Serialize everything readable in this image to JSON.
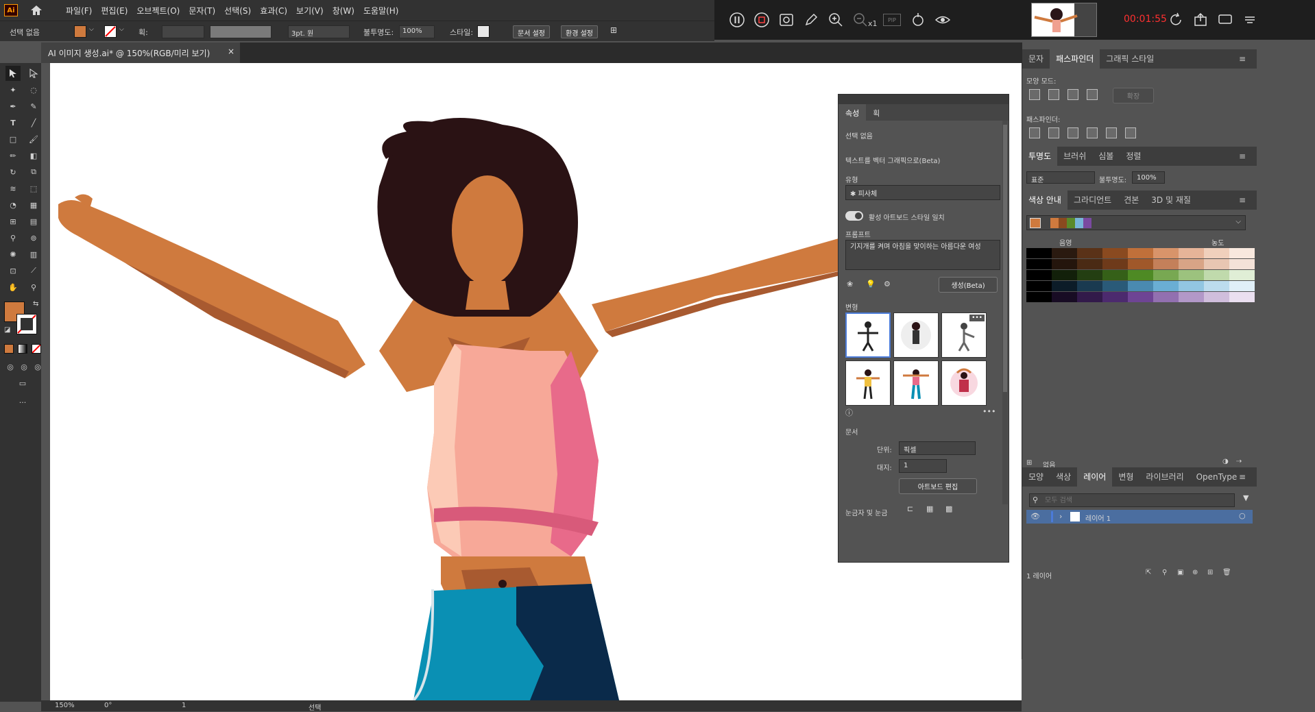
{
  "menubar": {
    "logo": "Ai",
    "items": [
      "파일(F)",
      "편집(E)",
      "오브젝트(O)",
      "문자(T)",
      "선택(S)",
      "효과(C)",
      "보기(V)",
      "창(W)",
      "도움말(H)"
    ]
  },
  "recorder": {
    "timer": "00:01:55",
    "zoom_label": "x1",
    "pip_label": "PIP"
  },
  "control": {
    "selection": "선택 없음",
    "stroke_label": "획:",
    "brush": "3pt. 원",
    "opacity_label": "불투명도:",
    "opacity": "100%",
    "style_label": "스타일:",
    "doc_setup": "문서 설정",
    "preferences": "환경 설정"
  },
  "tab": {
    "title": "AI 이미지 생성.ai* @ 150%(RGB/미리 보기)",
    "close": "×"
  },
  "status": {
    "zoom": "150%",
    "rotate": "0°",
    "artboard": "1",
    "tool": "선택"
  },
  "properties": {
    "tabs": [
      "속성",
      "획"
    ],
    "no_selection": "선택 없음",
    "section": "텍스트를 벡터 그래픽으로(Beta)",
    "type_label": "유형",
    "type_value": "피사체",
    "toggle_label": "활성 아트보드 스타일 일치",
    "prompt_label": "프롬프트",
    "prompt_text": "기지개를 켜며 아침을 맞이하는 아름다운 여성",
    "generate": "생성(Beta)",
    "variants_label": "변형",
    "document_label": "문서",
    "units_label": "단위:",
    "units_value": "픽셀",
    "artboard_label": "대지:",
    "artboard_value": "1",
    "edit_artboard": "아트보드 편집",
    "rulers_label": "눈금자 및 눈금"
  },
  "pathfinder": {
    "tabs": [
      "문자",
      "패스파인더",
      "그래픽 스타일"
    ],
    "shape_modes": "모양 모드:",
    "expand": "확장",
    "pathfinders": "패스파인더:"
  },
  "transparency": {
    "tabs": [
      "투명도",
      "브러쉬",
      "심볼",
      "정렬"
    ],
    "blend": "표준",
    "opacity_label": "불투명도:",
    "opacity": "100%"
  },
  "color_guide": {
    "tabs": [
      "색상 안내",
      "그라디언트",
      "견본",
      "3D 및 재질"
    ],
    "shade": "음영",
    "tint": "농도",
    "base_colors": [
      "#cf7a3e",
      "#cf7a3e",
      "#8a4a1f",
      "#5a8a2a",
      "#78b5d8",
      "#7a4aa0"
    ],
    "rows": [
      [
        "#000000",
        "#2a1a10",
        "#5a3218",
        "#8a4a20",
        "#c0703a",
        "#d8946a",
        "#e6b498",
        "#f0d0bc",
        "#f8e8de"
      ],
      [
        "#000000",
        "#24150c",
        "#4a2a14",
        "#6e3a1a",
        "#a0582a",
        "#c4805a",
        "#d8a486",
        "#e8c6b2",
        "#f4e2d8"
      ],
      [
        "#000000",
        "#12200a",
        "#233e12",
        "#356018",
        "#4e8a24",
        "#78a852",
        "#9cc27e",
        "#c0daac",
        "#e0eed6"
      ],
      [
        "#000000",
        "#0c1c28",
        "#1a3a50",
        "#2a5a78",
        "#4a8ab0",
        "#6aaed4",
        "#92c6e2",
        "#bcdcee",
        "#e0eff8"
      ],
      [
        "#000000",
        "#180c24",
        "#321a4a",
        "#4c2a6e",
        "#6e4494",
        "#9270b0",
        "#b298c8",
        "#d0bedc",
        "#eadff0"
      ]
    ],
    "footer": "없음"
  },
  "layers": {
    "tabs": [
      "모양",
      "색상",
      "레이어",
      "변형",
      "라이브러리",
      "OpenType"
    ],
    "search_placeholder": "모두 검색",
    "layer_name": "레이어 1",
    "count": "1 레이어"
  },
  "colors": {
    "fill": "#cf7a3e",
    "accent": "#4b7bd8"
  }
}
